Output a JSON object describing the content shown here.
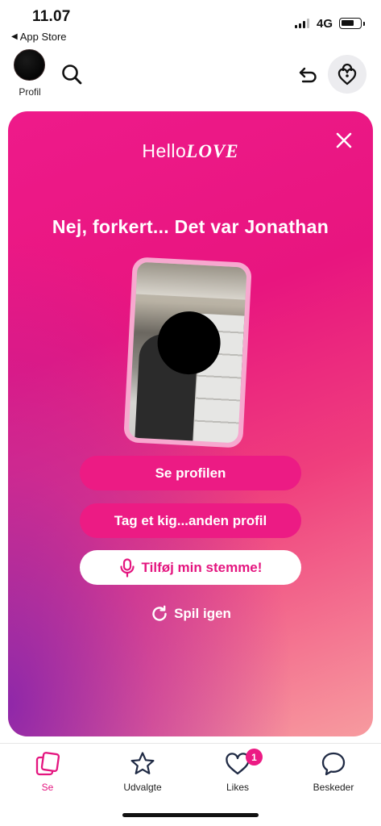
{
  "status_bar": {
    "time": "11.07",
    "back_app": "App Store",
    "network": "4G",
    "back_icon": "back-triangle-icon",
    "signal_icon": "signal-bars-icon",
    "battery_icon": "battery-icon"
  },
  "top_nav": {
    "profile_label": "Profil",
    "icons": {
      "search": "search-icon",
      "undo": "undo-icon",
      "lock": "heart-lock-icon"
    }
  },
  "card": {
    "brand_hello": "Hello",
    "brand_love": "LOVE",
    "headline": "Nej, forkert... Det var Jonathan",
    "buttons": {
      "see_profile": "Se profilen",
      "other_profile": "Tag et kig...anden profil",
      "add_voice": "Tilføj min stemme!"
    },
    "replay": "Spil igen",
    "icons": {
      "close": "close-icon",
      "mic": "microphone-icon",
      "replay": "replay-icon"
    }
  },
  "tabbar": {
    "tabs": [
      {
        "label": "Se",
        "icon": "cards-icon",
        "active": true
      },
      {
        "label": "Udvalgte",
        "icon": "star-icon",
        "active": false
      },
      {
        "label": "Likes",
        "icon": "heart-icon",
        "active": false,
        "badge": "1"
      },
      {
        "label": "Beskeder",
        "icon": "chat-bubble-icon",
        "active": false
      }
    ]
  },
  "colors": {
    "accent": "#ec1b84",
    "card_top": "#ee1a8a",
    "card_bottom_left": "#8a24aa",
    "card_bottom_right": "#f79b9f"
  }
}
